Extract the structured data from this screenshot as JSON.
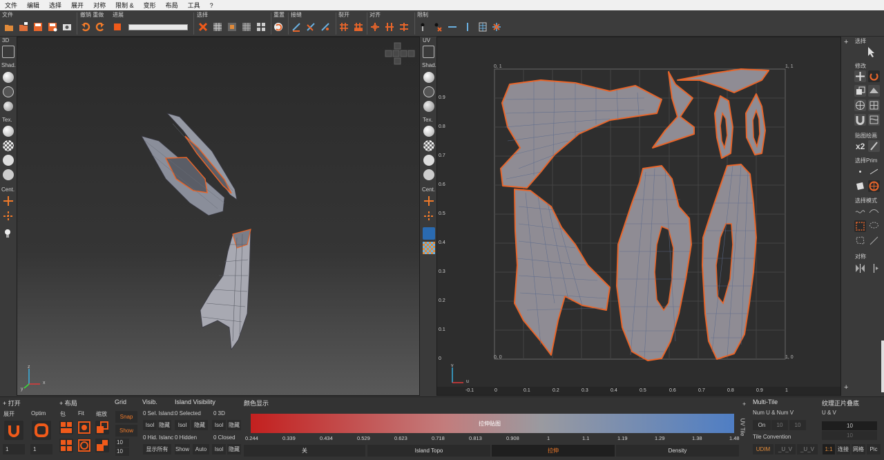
{
  "menu": [
    "文件",
    "编辑",
    "选择",
    "展开",
    "对称",
    "限制 &",
    "变形",
    "布局",
    "工具",
    "?"
  ],
  "toolbar": {
    "file": "文件",
    "undo_redo": "撤销 重做",
    "progress": "进展",
    "select": "选择",
    "reset": "重置",
    "stitch": "接缝",
    "cut": "裂开",
    "align": "对齐",
    "constraint": "限制"
  },
  "left_side": {
    "mode": "3D",
    "shad": "Shad.",
    "tex": "Tex.",
    "cent": "Cent."
  },
  "mid_side": {
    "mode": "UV",
    "shad": "Shad.",
    "tex": "Tex.",
    "cent": "Cent."
  },
  "uv_labels": {
    "tl": "0, 1",
    "tr": "1, 1",
    "bl": "0, 0",
    "br": "1, 0",
    "left_ticks": [
      "0.9",
      "0.8",
      "0.7",
      "0.6",
      "0.5",
      "0.4",
      "0.3",
      "0.2",
      "0.1",
      "0"
    ],
    "bottom_ticks": [
      "-0.1",
      "0",
      "0.1",
      "0.2",
      "0.3",
      "0.4",
      "0.5",
      "0.6",
      "0.7",
      "0.8",
      "0.9",
      "1"
    ]
  },
  "axes": {
    "u": "u",
    "v": "v",
    "x": "x",
    "y": "y",
    "z": "z"
  },
  "right_panel": {
    "select": "选择",
    "modify": "修改",
    "paint": "贴图绘画",
    "x2": "x2",
    "prim": "选择Prim",
    "mode": "选择模式",
    "sym": "对称"
  },
  "bottom": {
    "unfold": "+ 打开",
    "unfold_btn": "展开",
    "optim": "Optim",
    "n1": "1",
    "n2": "1",
    "layout": "+ 布局",
    "pack": "包",
    "fit": "Fit",
    "scale": "缩放",
    "grid": "Grid",
    "snap": "Snap",
    "show": "Show",
    "grid_v1": "10",
    "grid_v2": "10",
    "visib": "Visib.",
    "sel_island": "0 Sel. Island:",
    "hid_island": "0 Hid. Islanc",
    "isol": "Isol",
    "hide": "隐藏",
    "show_all": "显示所有",
    "island_vis": "Island Visibility",
    "selected": "0 Selected",
    "hidden": "0 Hidden",
    "three_d": "0 3D",
    "closed": "0 Closed",
    "show2": "Show",
    "auto": "Auto",
    "color_display": "颜色显示",
    "grad_label": "拉伸贴图",
    "scale_vals": [
      "0.244",
      "0.339",
      "0.434",
      "0.529",
      "0.623",
      "0.718",
      "0.813",
      "0.908",
      "1",
      "1.1",
      "1.19",
      "1.29",
      "1.38",
      "1.48"
    ],
    "modes": [
      "关",
      "Island Topo",
      "拉伸",
      "Density"
    ],
    "uv_tile": "UV Tile",
    "multi_tile": "Multi-Tile",
    "num_uv": "Num U & Num V",
    "on": "On",
    "m10a": "10",
    "m10b": "10",
    "tile_conv": "Tile Convention",
    "udim": "UDIM",
    "uv1": "_U_V",
    "uv2": "_U_V",
    "tex_overlay": "纹理正片叠底",
    "u_and_v": "U & V",
    "t10a": "10",
    "t10b": "10",
    "r11": "1:1",
    "connect": "连接",
    "mesh": "网格",
    "pic": "Pic"
  }
}
